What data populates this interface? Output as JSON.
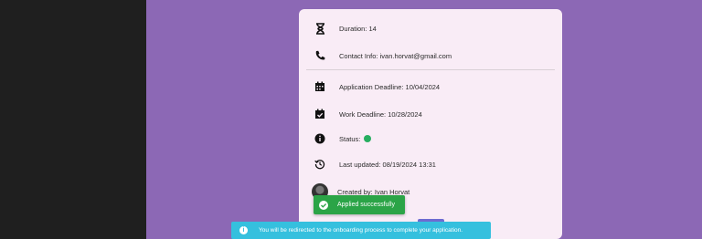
{
  "card": {
    "duration": "Duration: 14",
    "contact": "Contact Info: ivan.horvat@gmail.com",
    "application_deadline": "Application Deadline: 10/04/2024",
    "work_deadline": "Work Deadline: 10/28/2024",
    "status_label": "Status:",
    "last_updated": "Last updated: 08/19/2024 13:31",
    "created_by": "Created by: Ivan Horvat"
  },
  "toasts": {
    "success": "Applied successfully",
    "info": "You will be redirected to the onboarding process to complete your application."
  },
  "colors": {
    "purple": "#8c68b5",
    "card": "#f9ecf6",
    "success": "#2ba447",
    "info": "#35c0de",
    "status_dot": "#27ae60"
  },
  "icons": {
    "duration": "hourglass-icon",
    "contact": "phone-icon",
    "application_deadline": "calendar-icon",
    "work_deadline": "calendar-check-icon",
    "status": "info-icon",
    "last_updated": "history-icon",
    "created_by": "avatar"
  }
}
